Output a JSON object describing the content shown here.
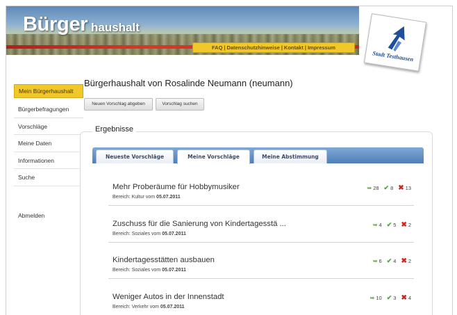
{
  "header": {
    "title_main": "Bürger",
    "title_sub": "haushalt",
    "links": [
      "FAQ",
      "Datenschutzhinweise",
      "Kontakt",
      "Impressum"
    ],
    "logo_text": "Stadt Testhausen"
  },
  "sidebar": {
    "items": [
      {
        "label": "Mein Bürgerhaushalt",
        "active": true
      },
      {
        "label": "Bürgerbefragungen"
      },
      {
        "label": "Vorschläge"
      },
      {
        "label": "Meine Daten"
      },
      {
        "label": "Informationen"
      },
      {
        "label": "Suche"
      }
    ],
    "logout": "Abmelden"
  },
  "main": {
    "heading": "Bürgerhaushalt von Rosalinde Neumann (neumann)",
    "buttons": {
      "new": "Neuen Vorschlag abgeben",
      "search": "Vorschlag suchen"
    },
    "section_title": "Ergebnisse",
    "tabs": [
      {
        "label": "Neueste Vorschläge"
      },
      {
        "label": "Meine Vorschläge",
        "active": true
      },
      {
        "label": "Meine Abstimmung"
      }
    ],
    "entries": [
      {
        "title": "Mehr Proberäume für Hobbymusiker",
        "area": "Bereich: Kultur vom",
        "date": "05.07.2011",
        "comments": "28",
        "yes": "8",
        "no": "13"
      },
      {
        "title": "Zuschuss für die Sanierung von Kindertagesstä ...",
        "area": "Bereich: Soziales vom",
        "date": "05.07.2011",
        "comments": "4",
        "yes": "5",
        "no": "2"
      },
      {
        "title": "Kindertagesstätten ausbauen",
        "area": "Bereich: Soziales vom",
        "date": "05.07.2011",
        "comments": "6",
        "yes": "4",
        "no": "2"
      },
      {
        "title": "Weniger Autos in der Innenstadt",
        "area": "Bereich: Verkehr vom",
        "date": "05.07.2011",
        "comments": "10",
        "yes": "3",
        "no": "4"
      }
    ]
  },
  "colors": {
    "accent_yellow": "#f1c82a",
    "tab_blue": "#5f8ec6",
    "yes_green": "#4aa53a",
    "no_red": "#d0241c"
  }
}
